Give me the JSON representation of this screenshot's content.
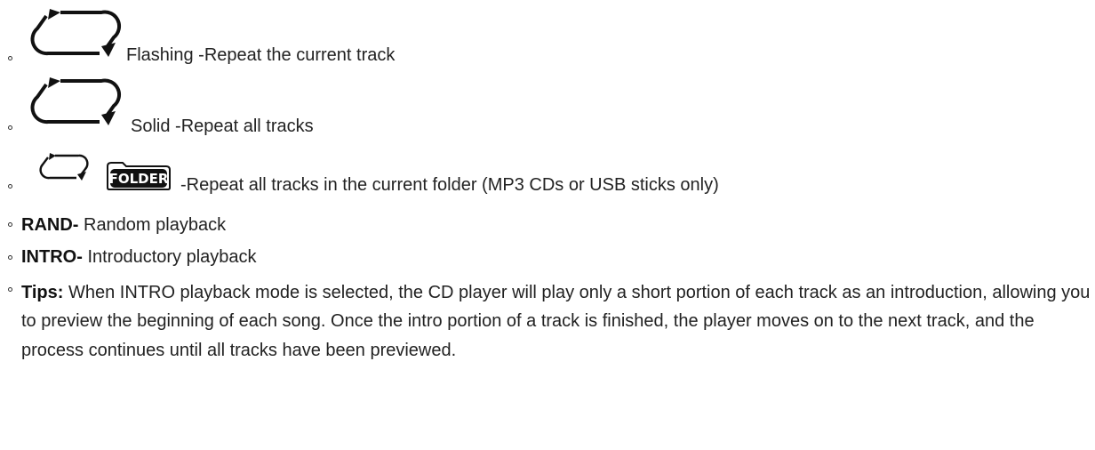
{
  "repeat_items": [
    {
      "icon": "repeat-arrows-icon",
      "text": "Flashing -Repeat the current track"
    },
    {
      "icon": "repeat-arrows-icon",
      "text": "Solid -Repeat all tracks"
    },
    {
      "icon": "repeat-arrows-icon",
      "badge": "FOLDER",
      "text": "-Repeat all tracks in the current folder (MP3 CDs or USB sticks only)"
    }
  ],
  "rand": {
    "label": "RAND-",
    "text": " Random playback"
  },
  "intro": {
    "label": "INTRO-",
    "text": " Introductory playback"
  },
  "tips": {
    "label": "Tips:",
    "text": " When INTRO playback mode is selected, the CD player will play only a short portion of each track as an introduction, allowing you to preview the beginning of each song. Once the intro portion of a track is finished, the player moves on to the next track, and the process continues until all tracks have been previewed."
  },
  "colors": {
    "text": "#222222",
    "badge_bg": "#111111",
    "badge_text": "#ffffff"
  }
}
